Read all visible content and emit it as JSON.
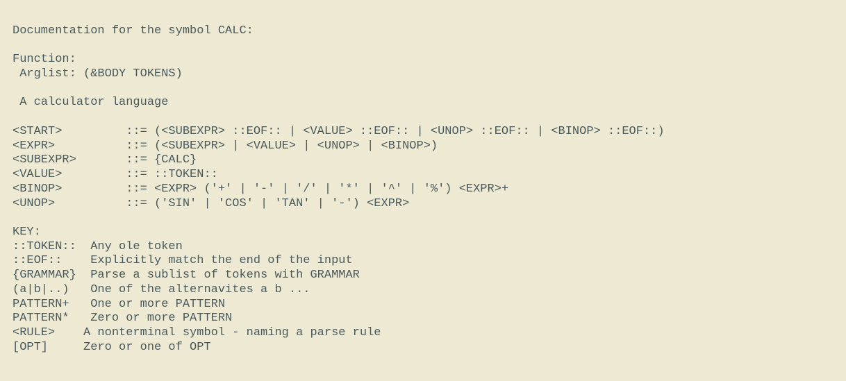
{
  "doc": {
    "title": "Documentation for the symbol CALC:",
    "func_label": "Function:",
    "arglist": " Arglist: (&BODY TOKENS)",
    "desc": " A calculator language",
    "grammar": {
      "start": "<START>         ::= (<SUBEXPR> ::EOF:: | <VALUE> ::EOF:: | <UNOP> ::EOF:: | <BINOP> ::EOF::)",
      "expr": "<EXPR>          ::= (<SUBEXPR> | <VALUE> | <UNOP> | <BINOP>)",
      "subexpr": "<SUBEXPR>       ::= {CALC}",
      "value": "<VALUE>         ::= ::TOKEN::",
      "binop": "<BINOP>         ::= <EXPR> ('+' | '-' | '/' | '*' | '^' | '%') <EXPR>+",
      "unop": "<UNOP>          ::= ('SIN' | 'COS' | 'TAN' | '-') <EXPR>"
    },
    "key_label": "KEY:",
    "key": {
      "token": "::TOKEN::  Any ole token",
      "eof": "::EOF::    Explicitly match the end of the input",
      "grammar": "{GRAMMAR}  Parse a sublist of tokens with GRAMMAR",
      "alt": "(a|b|..)   One of the alternavites a b ...",
      "plus": "PATTERN+   One or more PATTERN",
      "star": "PATTERN*   Zero or more PATTERN",
      "rule": "<RULE>    A nonterminal symbol - naming a parse rule",
      "opt": "[OPT]     Zero or one of OPT"
    }
  }
}
